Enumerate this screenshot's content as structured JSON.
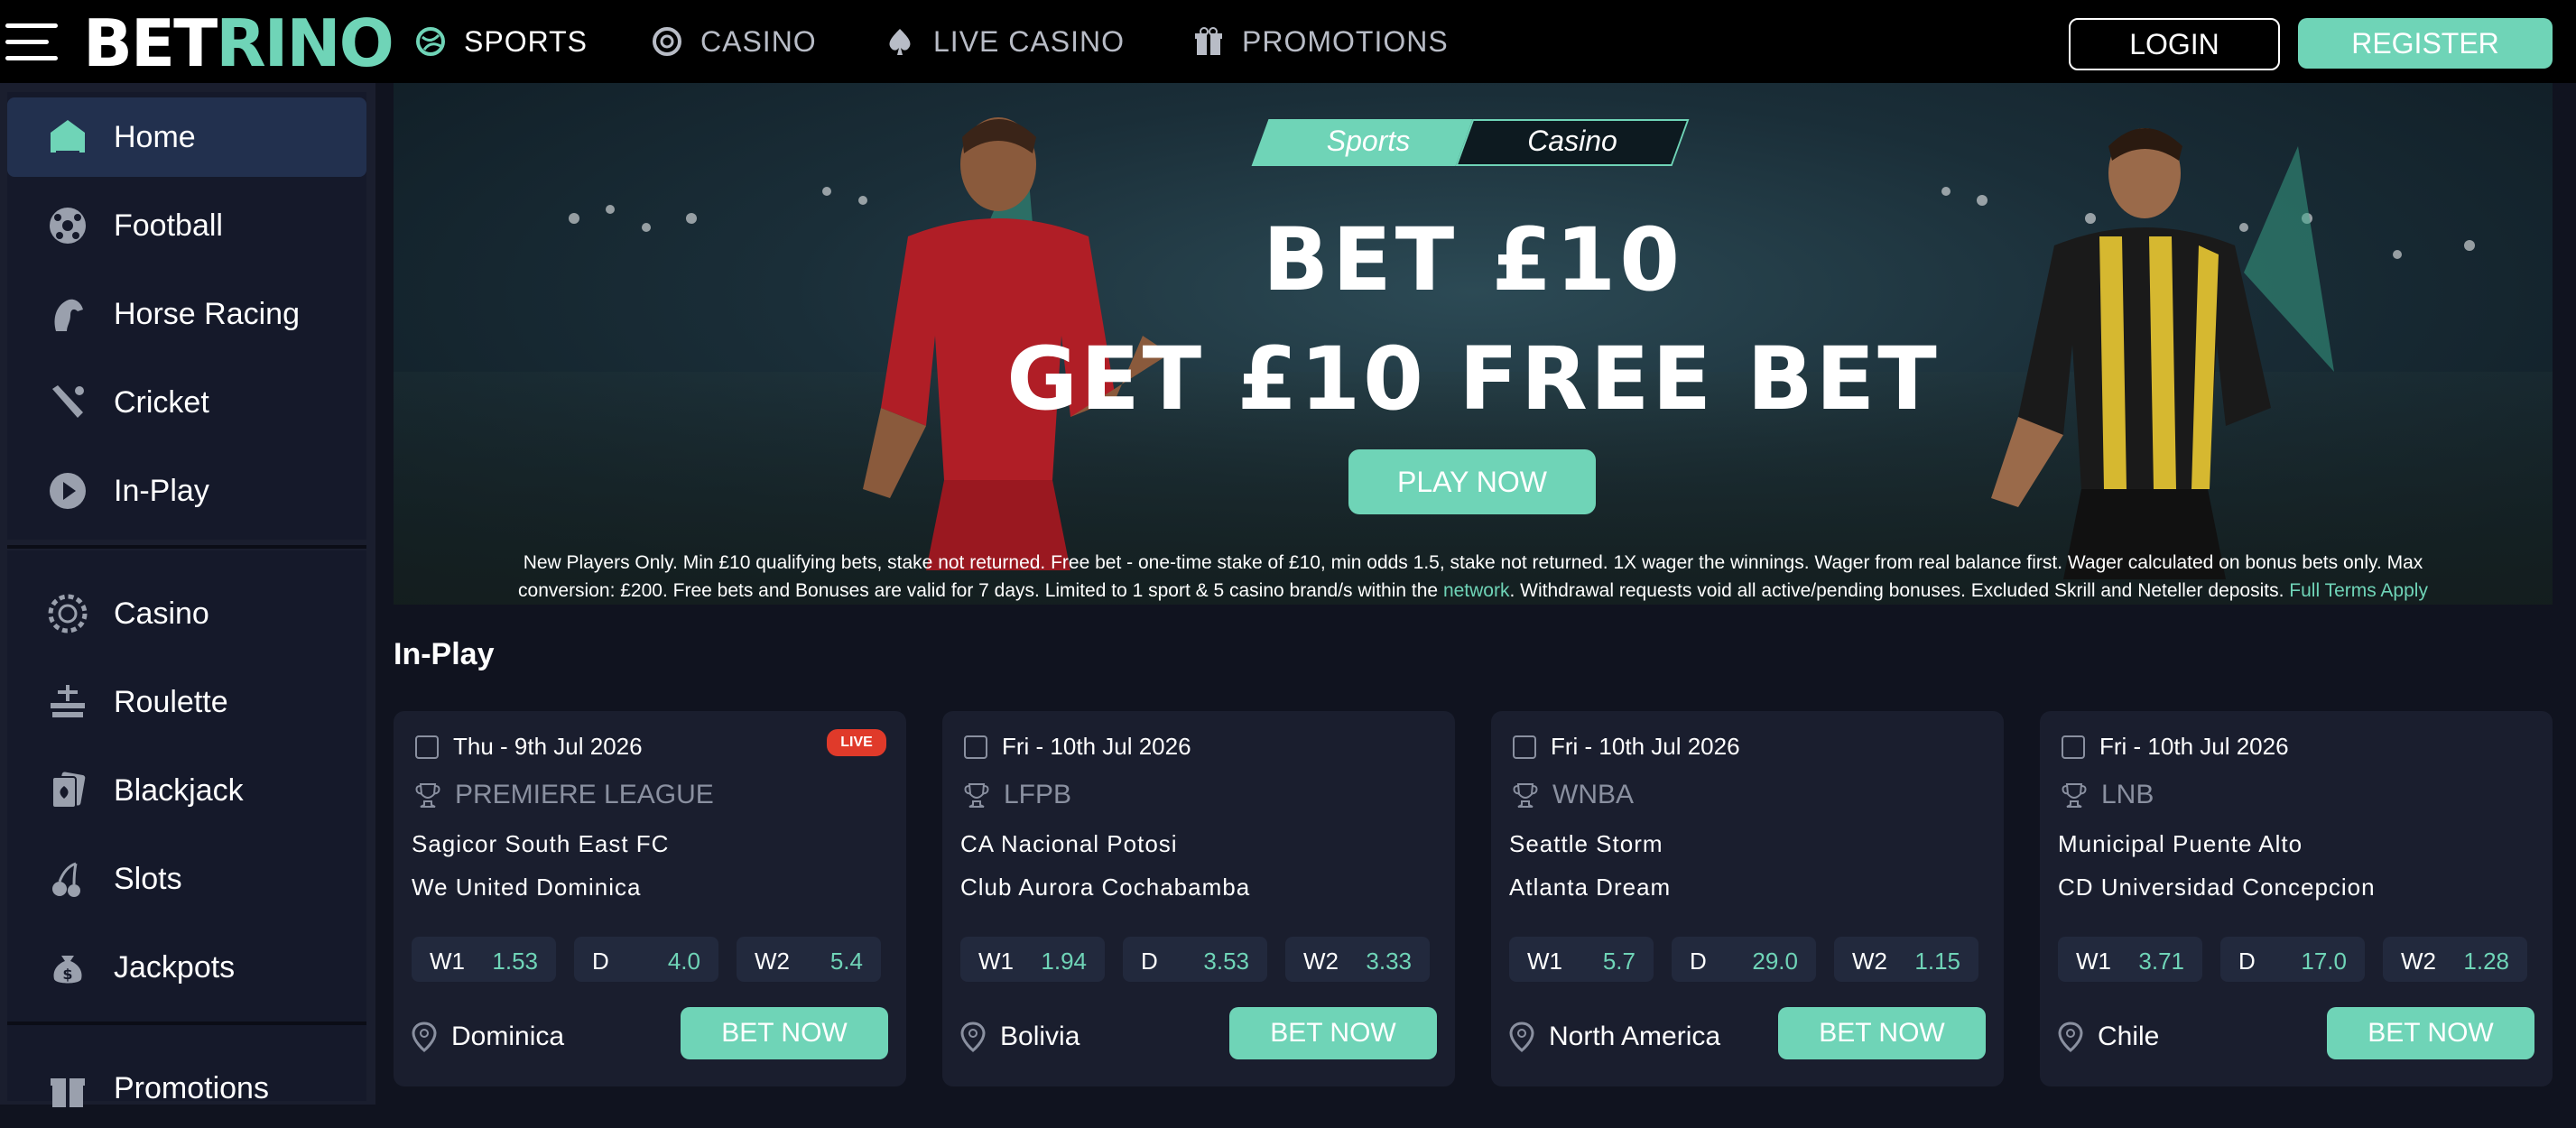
{
  "nav": {
    "logo_a": "BET",
    "logo_b": "RINO",
    "links": [
      {
        "label": "SPORTS",
        "icon": "football-globe-icon"
      },
      {
        "label": "CASINO",
        "icon": "casino-chip-icon"
      },
      {
        "label": "LIVE CASINO",
        "icon": "spade-icon"
      },
      {
        "label": "PROMOTIONS",
        "icon": "gift-icon"
      }
    ],
    "login": "LOGIN",
    "register": "REGISTER"
  },
  "sidebar": {
    "items": [
      {
        "label": "Home",
        "icon": "home-icon"
      },
      {
        "label": "Football",
        "icon": "football-icon"
      },
      {
        "label": "Horse Racing",
        "icon": "horse-icon"
      },
      {
        "label": "Cricket",
        "icon": "cricket-bat-icon"
      },
      {
        "label": "In-Play",
        "icon": "play-icon"
      },
      {
        "label": "Casino",
        "icon": "casino-chip-icon"
      },
      {
        "label": "Roulette",
        "icon": "roulette-icon"
      },
      {
        "label": "Blackjack",
        "icon": "cards-icon"
      },
      {
        "label": "Slots",
        "icon": "cherry-icon"
      },
      {
        "label": "Jackpots",
        "icon": "money-bag-icon"
      },
      {
        "label": "Promotions",
        "icon": "gift-icon"
      }
    ]
  },
  "hero": {
    "tab_sports": "Sports",
    "tab_casino": "Casino",
    "headline1": "BET £10",
    "headline2": "GET £10 FREE BET",
    "cta": "PLAY NOW",
    "terms_line1": "New Players Only. Min £10 qualifying bets, stake not returned. Free bet - one-time stake of £10, min odds 1.5, stake not returned. 1X wager the winnings. Wager from real balance first. Wager calculated on bonus bets only. Max",
    "terms_line2a": "conversion: £200. Free bets and Bonuses are valid for 7 days. Limited to 1 sport & 5 casino brand/s within the ",
    "terms_link": "network",
    "terms_line2b": ". Withdrawal requests void all active/pending bonuses. Excluded Skrill and Neteller deposits. ",
    "terms_full": "Full Terms Apply"
  },
  "inplay": {
    "title": "In-Play",
    "live_badge": "LIVE",
    "bet_label": "BET NOW",
    "cards": [
      {
        "date": "Thu - 9th Jul 2026",
        "league": "PREMIERE LEAGUE",
        "team1": "Sagicor South East FC",
        "team2": "We United Dominica",
        "odds": [
          {
            "k": "W1",
            "v": "1.53"
          },
          {
            "k": "D",
            "v": "4.0"
          },
          {
            "k": "W2",
            "v": "5.4"
          }
        ],
        "location": "Dominica",
        "live": true
      },
      {
        "date": "Fri - 10th Jul 2026",
        "league": "LFPB",
        "team1": "CA Nacional Potosi",
        "team2": "Club Aurora Cochabamba",
        "odds": [
          {
            "k": "W1",
            "v": "1.94"
          },
          {
            "k": "D",
            "v": "3.53"
          },
          {
            "k": "W2",
            "v": "3.33"
          }
        ],
        "location": "Bolivia",
        "live": false
      },
      {
        "date": "Fri - 10th Jul 2026",
        "league": "WNBA",
        "team1": "Seattle Storm",
        "team2": "Atlanta Dream",
        "odds": [
          {
            "k": "W1",
            "v": "5.7"
          },
          {
            "k": "D",
            "v": "29.0"
          },
          {
            "k": "W2",
            "v": "1.15"
          }
        ],
        "location": "North America",
        "live": false
      },
      {
        "date": "Fri - 10th Jul 2026",
        "league": "LNB",
        "team1": "Municipal Puente Alto",
        "team2": "CD Universidad Concepcion",
        "odds": [
          {
            "k": "W1",
            "v": "3.71"
          },
          {
            "k": "D",
            "v": "17.0"
          },
          {
            "k": "W2",
            "v": "1.28"
          }
        ],
        "location": "Chile",
        "live": false
      }
    ]
  },
  "colors": {
    "accent": "#6fd4b7",
    "live": "#e03a2a",
    "bg": "#10131f"
  }
}
